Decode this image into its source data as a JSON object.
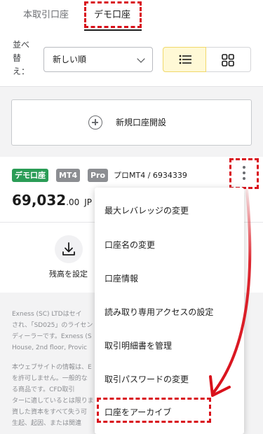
{
  "tabs": {
    "live": "本取引口座",
    "demo": "デモ口座"
  },
  "sort": {
    "label": "並べ替え：",
    "selected": "新しい順"
  },
  "new_account": {
    "label": "新規口座開設"
  },
  "account": {
    "badges": {
      "type": "デモ口座",
      "platform": "MT4",
      "tier": "Pro"
    },
    "name": "プロMT4 / 6934339",
    "balance_int": "69,032",
    "balance_dec": ".00",
    "currency": "JP",
    "deposit_label": "残高を設定"
  },
  "menu": {
    "items": [
      "最大レバレッジの変更",
      "口座名の変更",
      "口座情報",
      "読み取り専用アクセスの設定",
      "取引明細書を管理",
      "取引パスワードの変更",
      "口座をアーカイブ"
    ]
  },
  "footer": {
    "lines": [
      "Exness (SC) LTDはセイ",
      "され、「SD025」のライセン",
      "ディーラーです。Exness (S",
      "House, 2nd floor, Provic",
      "",
      "本ウェブサイトの情報は、E",
      "を許可しません。一般的な",
      "る商品です。CFD取引",
      "ターに適しているとは限りま",
      "資した資本をすべて失う可",
      "生起、起因、または関連"
    ]
  },
  "colors": {
    "highlight": "#d9111b",
    "demo_badge": "#2a9c56",
    "gray_badge": "#8c8e92",
    "selected_view": "#fff9d6"
  },
  "icons": [
    "plus-circle-icon",
    "chevron-down-icon",
    "list-view-icon",
    "grid-view-icon",
    "kebab-menu-icon",
    "download-icon"
  ]
}
